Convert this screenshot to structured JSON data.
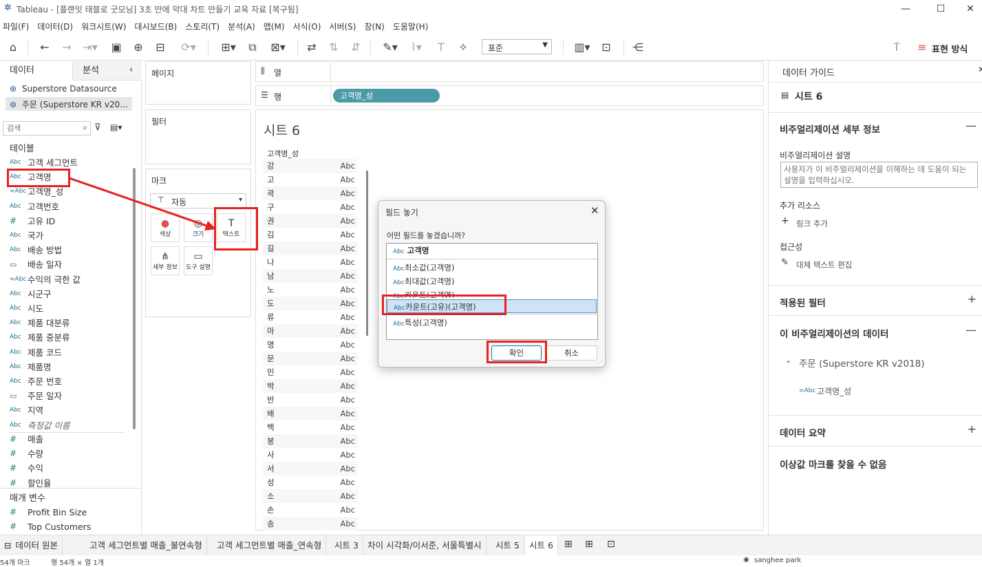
{
  "window": {
    "title": "Tableau - [플랜잇 태블로 굿모닝] 3초 만에 막대 차트 만들기 교육 자료 [복구됨]"
  },
  "menu": [
    "파일(F)",
    "데이터(D)",
    "워크시트(W)",
    "대시보드(B)",
    "스토리(T)",
    "분석(A)",
    "맵(M)",
    "서식(O)",
    "서버(S)",
    "창(N)",
    "도움말(H)"
  ],
  "toolbar": {
    "fit_select": "표준",
    "show_me": "표현 방식"
  },
  "left": {
    "tab_data": "데이터",
    "tab_analysis": "분석",
    "datasource1": "Superstore Datasource",
    "datasource2": "주문 (Superstore KR v20...",
    "search_placeholder": "검색",
    "tables_header": "테이블",
    "fields": [
      {
        "icon": "Abc",
        "name": "고객 세그먼트"
      },
      {
        "icon": "Abc",
        "name": "고객명"
      },
      {
        "icon": "=Abc",
        "name": "고객명_성"
      },
      {
        "icon": "Abc",
        "name": "고객번호"
      },
      {
        "icon": "#",
        "name": "고유 ID"
      },
      {
        "icon": "Abc",
        "name": "국가"
      },
      {
        "icon": "Abc",
        "name": "배송 방법"
      },
      {
        "icon": "cal",
        "name": "배송 일자"
      },
      {
        "icon": "=Abc",
        "name": "수익의 극한 값"
      },
      {
        "icon": "Abc",
        "name": "시군구"
      },
      {
        "icon": "Abc",
        "name": "시도"
      },
      {
        "icon": "Abc",
        "name": "제품 대분류"
      },
      {
        "icon": "Abc",
        "name": "제품 중분류"
      },
      {
        "icon": "Abc",
        "name": "제품 코드"
      },
      {
        "icon": "Abc",
        "name": "제품명"
      },
      {
        "icon": "Abc",
        "name": "주문 번호"
      },
      {
        "icon": "cal",
        "name": "주문 일자"
      },
      {
        "icon": "Abc",
        "name": "지역"
      },
      {
        "icon": "Abc",
        "name": "측정값 이름"
      }
    ],
    "measures": [
      {
        "icon": "#",
        "name": "매출"
      },
      {
        "icon": "#",
        "name": "수량"
      },
      {
        "icon": "#",
        "name": "수익"
      },
      {
        "icon": "#",
        "name": "할인율"
      }
    ],
    "params_header": "매개 변수",
    "params": [
      {
        "icon": "#",
        "name": "Profit Bin Size"
      },
      {
        "icon": "#",
        "name": "Top Customers"
      }
    ]
  },
  "shelves": {
    "pages": "페이지",
    "filters": "필터",
    "marks": "마크",
    "mark_type": "자동",
    "columns": "열",
    "rows": "행",
    "row_pill": "고객명_성",
    "mark_buttons": [
      {
        "label": "색상",
        "glyph": "●"
      },
      {
        "label": "크기",
        "glyph": "◎"
      },
      {
        "label": "텍스트",
        "glyph": "T"
      },
      {
        "label": "세부 정보",
        "glyph": "⋔"
      },
      {
        "label": "도구 설명",
        "glyph": "▭"
      }
    ]
  },
  "sheet": {
    "title": "시트 6",
    "col_header": "고객명_성",
    "abc": "Abc",
    "rows": [
      "강",
      "고",
      "곽",
      "구",
      "권",
      "김",
      "길",
      "나",
      "남",
      "노",
      "도",
      "류",
      "마",
      "명",
      "문",
      "민",
      "박",
      "반",
      "배",
      "백",
      "봉",
      "사",
      "서",
      "성",
      "소",
      "손",
      "송"
    ]
  },
  "dialog": {
    "title": "필드 놓기",
    "question": "어떤 필드를 놓겠습니까?",
    "selected_field": "고객명",
    "options": [
      "최소값(고객명)",
      "최대값(고객명)",
      "카운트(고객명)",
      "카운트(고유)(고객명)",
      "특성(고객명)"
    ],
    "ok": "확인",
    "cancel": "취소"
  },
  "right": {
    "header": "데이터 가이드",
    "sheet": "시트 6",
    "viz_details": "비주얼리제이션 세부 정보",
    "viz_desc_label": "비주얼리제이션 설명",
    "viz_desc_placeholder": "사용자가 이 비주얼리제이션을 이해하는 데 도움이 되는 설명을 입력하십시오.",
    "extra_resources": "추가 리소스",
    "add_link": "링크 추가",
    "accessibility": "접근성",
    "alt_text": "대체 텍스트 편집",
    "applied_filters": "적용된 필터",
    "viz_data": "이 비주얼리제이션의 데이터",
    "datasource": "주문 (Superstore KR v2018)",
    "field": "고객명_성",
    "data_summary": "데이터 요약",
    "outlier": "이상값 마크를 찾을 수 없음"
  },
  "tabs": [
    "데이터 원본",
    "고객 세그먼트별 매출_불연속형",
    "고객 세그먼트별 매출_연속형",
    "시트 3",
    "차이 시각화/이서준, 서울특별시",
    "시트 5",
    "시트 6"
  ],
  "status": {
    "marks": "54개 마크",
    "rows_cols": "행 54개 × 열 1개",
    "user": "sanghee park"
  }
}
